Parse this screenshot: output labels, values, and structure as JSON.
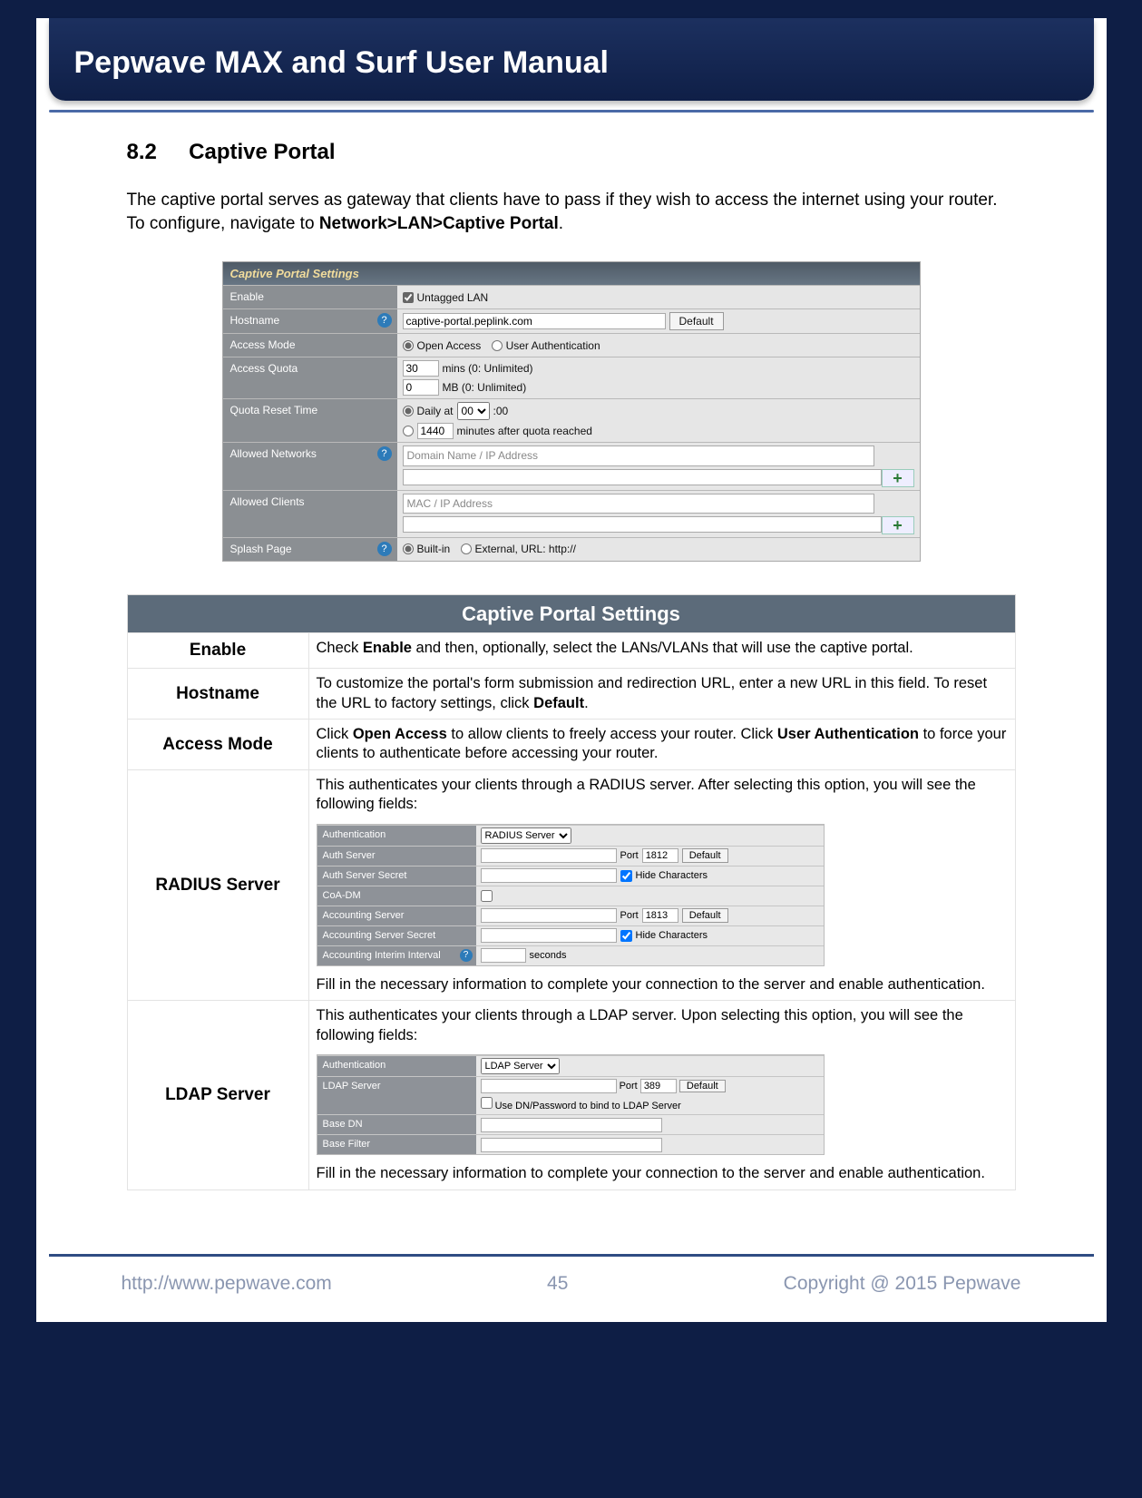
{
  "header": {
    "title": "Pepwave MAX and Surf User Manual"
  },
  "section": {
    "num": "8.2",
    "title": "Captive Portal",
    "intro_a": "The captive portal serves as gateway that clients have to pass if they wish to access the internet using your router. To configure, navigate to ",
    "intro_b": "Network>LAN>Captive Portal",
    "intro_c": "."
  },
  "shot1": {
    "title": "Captive Portal Settings",
    "enable": "Enable",
    "enable_opt": "Untagged LAN",
    "hostname": "Hostname",
    "hostname_val": "captive-portal.peplink.com",
    "default_btn": "Default",
    "access_mode": "Access Mode",
    "open_access": "Open Access",
    "user_auth": "User Authentication",
    "access_quota": "Access Quota",
    "mins_val": "30",
    "mins_lbl": "mins (0: Unlimited)",
    "mb_val": "0",
    "mb_lbl": "MB (0: Unlimited)",
    "quota_reset": "Quota Reset Time",
    "daily_at": "Daily at",
    "hour": "00",
    "colon": ":00",
    "alt_val": "1440",
    "alt_lbl": "minutes after quota reached",
    "allowed_networks": "Allowed Networks",
    "allowed_networks_ph": "Domain Name / IP Address",
    "allowed_clients": "Allowed Clients",
    "allowed_clients_ph": "MAC / IP Address",
    "splash_page": "Splash Page",
    "builtin": "Built-in",
    "external": "External, URL: http://",
    "plus": "+"
  },
  "defTable": {
    "header": "Captive Portal Settings",
    "rows": {
      "enable": {
        "k": "Enable",
        "v_a": "Check ",
        "v_b": "Enable",
        "v_c": " and then, optionally, select the LANs/VLANs that will use the captive portal."
      },
      "hostname": {
        "k": "Hostname",
        "v_a": "To customize the portal's form submission and redirection URL, enter a new URL in this field. To reset the URL to factory settings, click ",
        "v_b": "Default",
        "v_c": "."
      },
      "access_mode": {
        "k": "Access Mode",
        "v_a": "Click ",
        "v_b": "Open Access",
        "v_c": " to allow clients to freely access your router. Click ",
        "v_d": "User Authentication",
        "v_e": " to force your clients to authenticate before accessing your router."
      },
      "radius": {
        "k": "RADIUS Server",
        "pre": "This authenticates your clients through a RADIUS server. After selecting this option, you will see the following fields:",
        "post": "Fill in the necessary information to complete your connection to the server and enable authentication."
      },
      "ldap": {
        "k": "LDAP Server",
        "pre": "This authenticates your clients through a LDAP server. Upon selecting this option, you will see the following fields:",
        "post": "Fill in the necessary information to complete your connection to the server and enable authentication."
      }
    }
  },
  "radiusShot": {
    "auth": "Authentication",
    "auth_val": "RADIUS Server",
    "auth_server": "Auth Server",
    "port": "Port",
    "port_auth": "1812",
    "default": "Default",
    "auth_secret": "Auth Server Secret",
    "hide": "Hide Characters",
    "coa": "CoA-DM",
    "acct_server": "Accounting Server",
    "port_acct": "1813",
    "acct_secret": "Accounting Server Secret",
    "acct_interval": "Accounting Interim Interval",
    "seconds": "seconds"
  },
  "ldapShot": {
    "auth": "Authentication",
    "auth_val": "LDAP Server",
    "ldap_server": "LDAP Server",
    "port": "Port",
    "port_val": "389",
    "default": "Default",
    "use_dn": "Use DN/Password to bind to LDAP Server",
    "base_dn": "Base DN",
    "base_filter": "Base Filter"
  },
  "footer": {
    "url": "http://www.pepwave.com",
    "page": "45",
    "copyright": "Copyright @ 2015 Pepwave"
  }
}
